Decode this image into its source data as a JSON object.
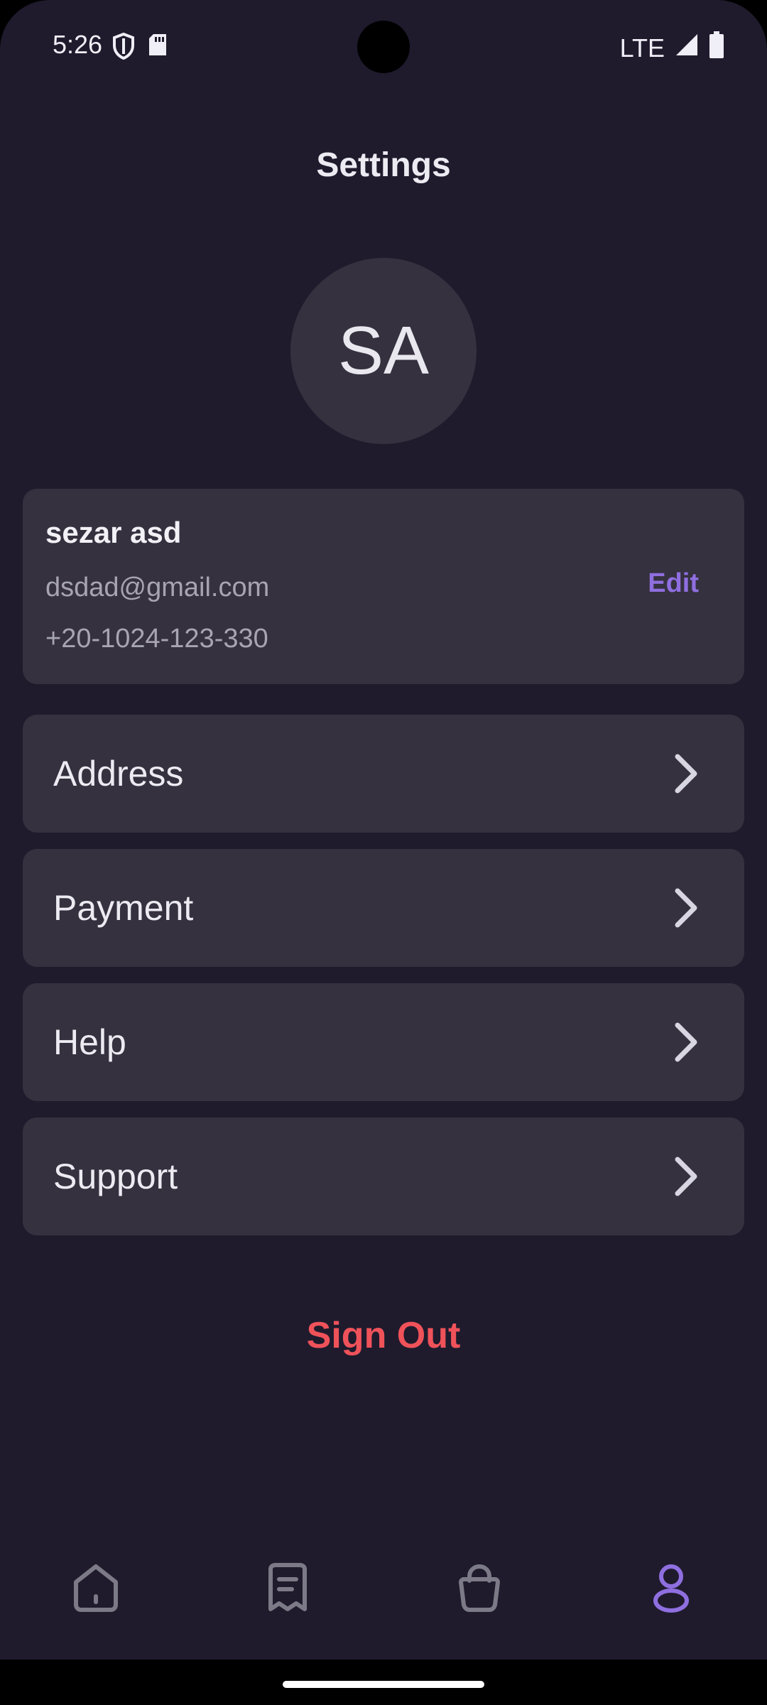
{
  "status_bar": {
    "time": "5:26",
    "network": "LTE",
    "icons": [
      "shield-icon",
      "sd-card-icon",
      "signal-icon",
      "battery-icon"
    ]
  },
  "header": {
    "title": "Settings"
  },
  "profile": {
    "initials": "SA",
    "name": "sezar asd",
    "email": "dsdad@gmail.com",
    "phone": "+20-1024-123-330",
    "edit_label": "Edit"
  },
  "menu": {
    "items": [
      {
        "label": "Address",
        "icon": "chevron-right-icon"
      },
      {
        "label": "Payment",
        "icon": "chevron-right-icon"
      },
      {
        "label": "Help",
        "icon": "chevron-right-icon"
      },
      {
        "label": "Support",
        "icon": "chevron-right-icon"
      }
    ]
  },
  "sign_out_label": "Sign Out",
  "bottom_nav": {
    "items": [
      {
        "icon": "home-icon",
        "active": false
      },
      {
        "icon": "receipt-icon",
        "active": false
      },
      {
        "icon": "shopping-bag-icon",
        "active": false
      },
      {
        "icon": "profile-icon",
        "active": true
      }
    ]
  },
  "colors": {
    "background": "#1f1b2d",
    "card": "#35313f",
    "accent": "#8f6fe0",
    "danger": "#f0525a",
    "inactive_icon": "#7d7a88"
  }
}
